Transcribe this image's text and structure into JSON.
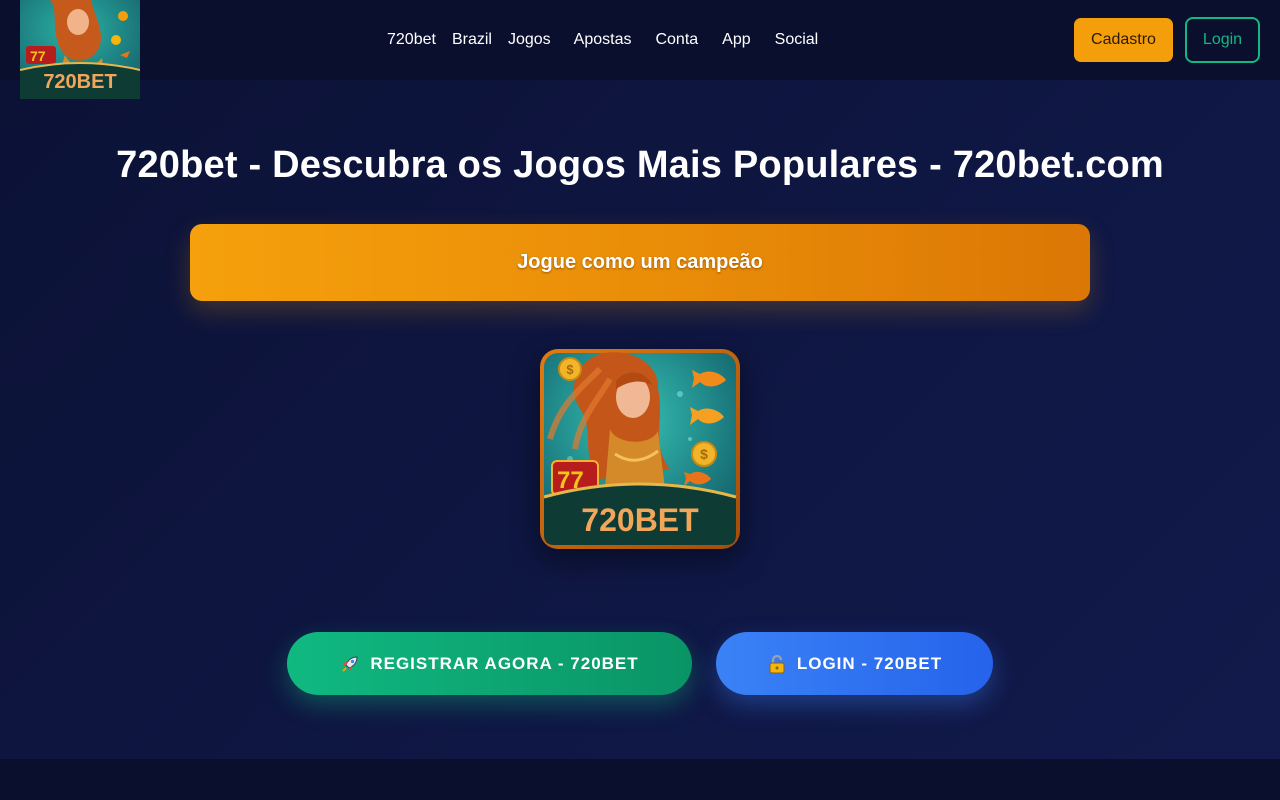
{
  "header": {
    "logo_text": "720BET",
    "nav": [
      "720bet",
      "Brazil",
      "Jogos",
      "Apostas",
      "Conta",
      "App",
      "Social"
    ],
    "cadastro_label": "Cadastro",
    "login_label": "Login"
  },
  "main": {
    "title": "720bet - Descubra os Jogos Mais Populares - 720bet.com",
    "banner_text": "Jogue como um campeão",
    "app_icon_text": "720BET",
    "register_button": "REGISTRAR AGORA - 720BET",
    "register_icon": "rocket-icon",
    "login_button": "LOGIN - 720BET",
    "login_icon": "lock-icon"
  },
  "colors": {
    "background": "#0b1030",
    "accent_orange": "#f59e0b",
    "accent_green": "#10b981",
    "accent_blue": "#3b82f6"
  }
}
